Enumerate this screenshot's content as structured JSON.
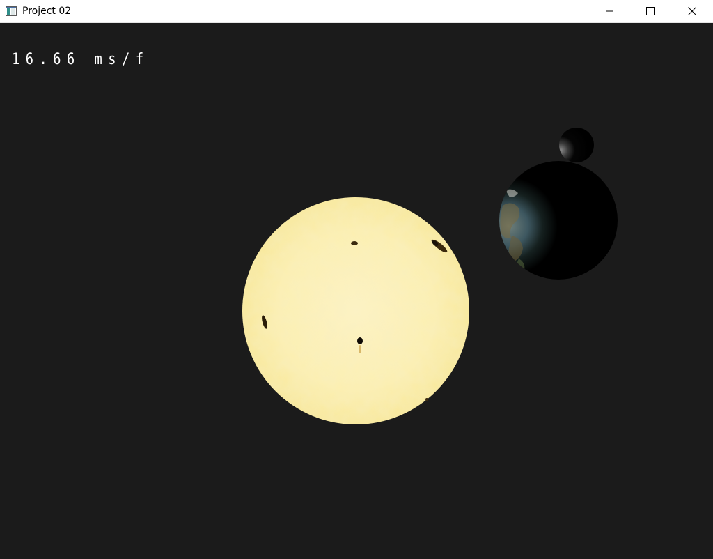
{
  "window": {
    "title": "Project 02",
    "icon": "app-window-icon",
    "controls": {
      "minimize_icon": "minimize-icon",
      "maximize_icon": "maximize-icon",
      "close_icon": "close-icon"
    }
  },
  "overlay": {
    "frame_time": "16.66 ms/f"
  },
  "scene": {
    "background_color": "#1b1b1b",
    "objects": [
      "sun",
      "earth",
      "moon"
    ]
  }
}
